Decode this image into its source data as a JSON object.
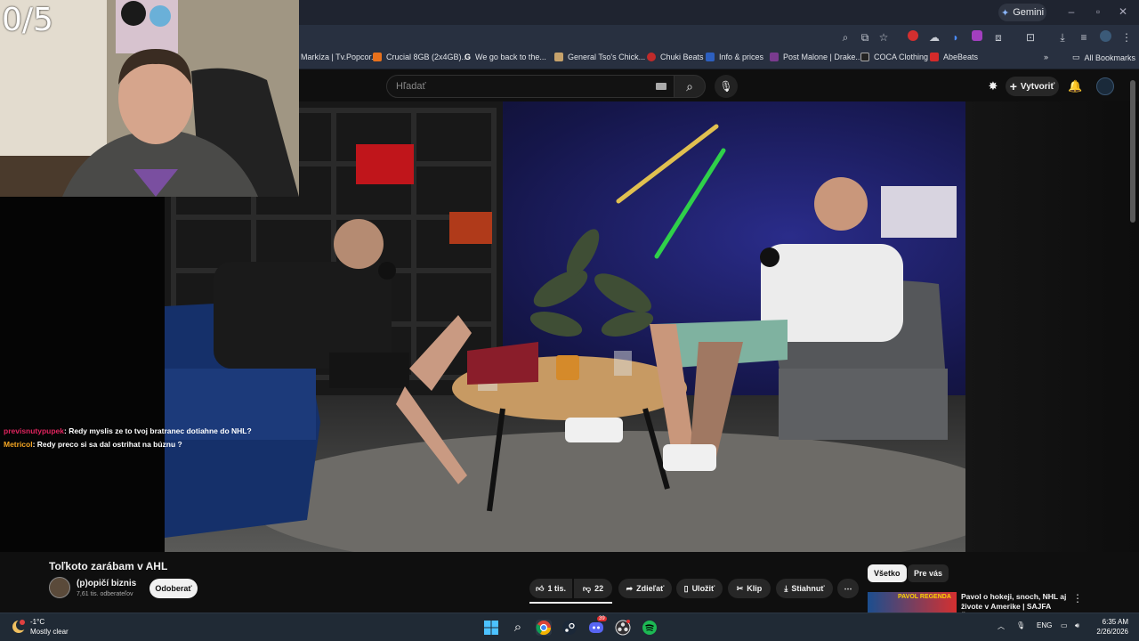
{
  "browser": {
    "gemini_label": "Gemini",
    "bookmarks": [
      {
        "label": "Markíza | Tv.Popcor...",
        "color": "#2b2b2b"
      },
      {
        "label": "Crucial 8GB (2x4GB)...",
        "color": "#e8711c"
      },
      {
        "label": "We go back to the...",
        "color": "#4a4a4a"
      },
      {
        "label": "General Tso's Chick...",
        "color": "#c6a26b"
      },
      {
        "label": "Chuki Beats",
        "color": "#c02a2a"
      },
      {
        "label": "Info & prices",
        "color": "#2d5fbf"
      },
      {
        "label": "Post Malone | Drake...",
        "color": "#7a3b8f"
      },
      {
        "label": "COCA Clothing",
        "color": "#222222"
      },
      {
        "label": "AbeBeats",
        "color": "#d42a2a"
      }
    ],
    "all_bookmarks_label": "All Bookmarks"
  },
  "youtube": {
    "search_placeholder": "Hľadať",
    "create_label": "Vytvoriť",
    "video_title": "Toľkoto zarábam v AHL",
    "channel_name": "(p)opičí biznis",
    "channel_subs": "7,61 tis. odberateľov",
    "subscribe_label": "Odoberať",
    "likes": "1 tis.",
    "dislikes": "22",
    "share_label": "Zdieľať",
    "save_label": "Uložiť",
    "clip_label": "Klip",
    "download_label": "Stiahnuť",
    "chips": [
      "Všetko",
      "Pre vás"
    ],
    "reco": {
      "thumb_text": "PAVOL REGENDA",
      "title": "Pavol o hokeji, snoch, NHL aj živote v Amerike | SAJFA ŠOU"
    }
  },
  "stream_overlay": {
    "counter": "0/5",
    "chat": [
      {
        "user": "previsnutypupek",
        "user_color": "#e0245e",
        "message": ": Redy myslis ze to tvoj bratranec dotiahne do NHL?"
      },
      {
        "user": "Metricol",
        "user_color": "#f5a623",
        "message": ": Redy preco si sa dal ostrihat na búznu ?"
      }
    ]
  },
  "taskbar": {
    "temperature": "-1°C",
    "weather": "Mostly clear",
    "language": "ENG",
    "time": "6:35 AM",
    "date": "2/26/2026",
    "discord_badge": "39"
  }
}
